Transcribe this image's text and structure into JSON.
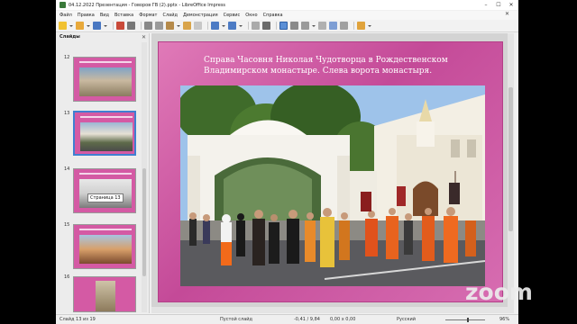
{
  "window": {
    "title": "04.12.2022 Презентация - Говоров ГВ (2).pptx - LibreOffice Impress"
  },
  "menu": [
    "Файл",
    "Правка",
    "Вид",
    "Вставка",
    "Формат",
    "Слайд",
    "Демонстрация",
    "Сервис",
    "Окно",
    "Справка"
  ],
  "slides_panel": {
    "header": "Слайды",
    "thumbnails": [
      {
        "num": "12"
      },
      {
        "num": "13"
      },
      {
        "num": "14"
      },
      {
        "num": "15"
      },
      {
        "num": "16"
      }
    ],
    "tooltip": "Страница 13"
  },
  "slide": {
    "title": "Справа Часовня Николая Чудотворца в Рождественском Владимирском монастыре. Слева ворота монастыря."
  },
  "status": {
    "slide_info": "Слайд 13 из 19",
    "layout": "Пустой слайд",
    "position": "-0,41 / 9,84",
    "size": "0,00 x 0,00",
    "language": "Русский",
    "zoom": "96%"
  },
  "watermark": "zoom",
  "colors": {
    "slide_bg": "#d45aa4",
    "selection": "#3f7fd1"
  }
}
